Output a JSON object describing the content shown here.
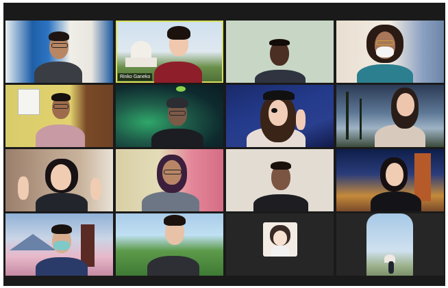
{
  "window": {
    "title": ""
  },
  "participants": [
    {
      "name": "",
      "label_visible": false
    },
    {
      "name": "Rinko Ganeko",
      "label_visible": true,
      "active_speaker": true
    },
    {
      "name": "",
      "label_visible": false
    },
    {
      "name": "",
      "label_visible": false
    },
    {
      "name": "",
      "label_visible": false
    },
    {
      "name": "",
      "label_visible": false
    },
    {
      "name": "",
      "label_visible": false
    },
    {
      "name": "",
      "label_visible": false
    },
    {
      "name": "",
      "label_visible": false
    },
    {
      "name": "",
      "label_visible": false
    },
    {
      "name": "",
      "label_visible": false
    },
    {
      "name": "",
      "label_visible": false
    },
    {
      "name": "",
      "label_visible": false
    },
    {
      "name": "",
      "label_visible": false
    },
    {
      "name": "",
      "label_visible": false
    },
    {
      "name": "",
      "label_visible": false
    }
  ],
  "colors": {
    "active_border": "#d8e05a",
    "background": "#1a1a1a"
  }
}
